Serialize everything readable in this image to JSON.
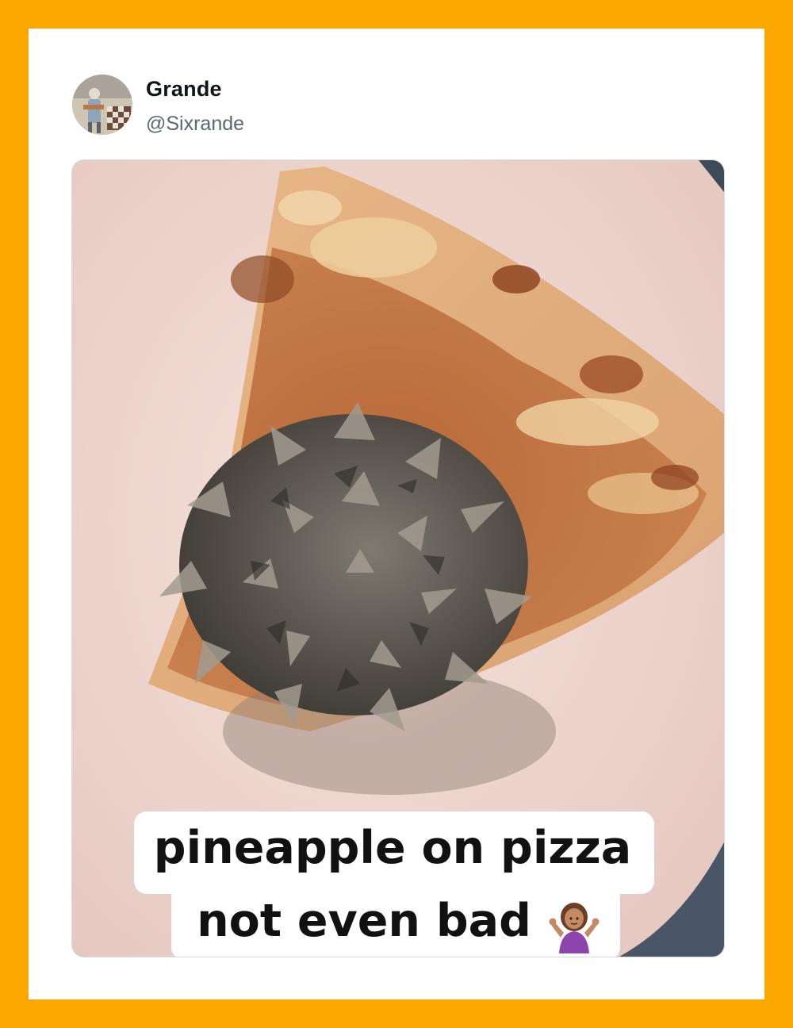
{
  "post": {
    "display_name": "Grande",
    "handle": "@Sixrande",
    "avatar_icon": "avatar-icon"
  },
  "media": {
    "caption_line1": "pineapple on pizza",
    "caption_line2": "not even bad",
    "emoji": "person-shrugging-emoji"
  },
  "colors": {
    "frame": "#FDA800",
    "card": "#FFFFFF",
    "plate": "#EFD6CF",
    "name": "#0F1419",
    "handle": "#5B6670"
  }
}
